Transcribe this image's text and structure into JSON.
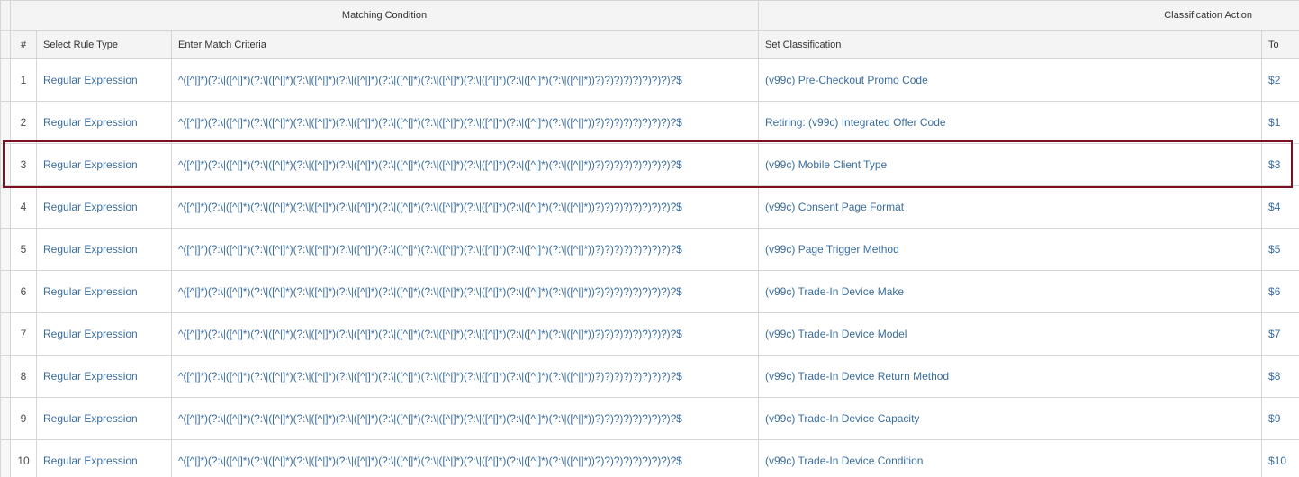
{
  "table": {
    "group_headers": {
      "matching_condition": "Matching Condition",
      "classification_action": "Classification Action"
    },
    "columns": {
      "num": "#",
      "rule_type": "Select Rule Type",
      "match_criteria": "Enter Match Criteria",
      "set_classification": "Set Classification",
      "to": "To"
    },
    "rows": [
      {
        "num": "1",
        "rule_type": "Regular Expression",
        "criteria": "^([^|]*)(?:\\|([^|]*)(?:\\|([^|]*)(?:\\|([^|]*)(?:\\|([^|]*)(?:\\|([^|]*)(?:\\|([^|]*)(?:\\|([^|]*)(?:\\|([^|]*)(?:\\|([^|]*))?)?)?)?)?)?)?)?)?$",
        "classification": "(v99c) Pre-Checkout Promo Code",
        "to": "$2"
      },
      {
        "num": "2",
        "rule_type": "Regular Expression",
        "criteria": "^([^|]*)(?:\\|([^|]*)(?:\\|([^|]*)(?:\\|([^|]*)(?:\\|([^|]*)(?:\\|([^|]*)(?:\\|([^|]*)(?:\\|([^|]*)(?:\\|([^|]*)(?:\\|([^|]*))?)?)?)?)?)?)?)?)?$",
        "classification": "Retiring: (v99c) Integrated Offer Code",
        "to": "$1"
      },
      {
        "num": "3",
        "rule_type": "Regular Expression",
        "criteria": "^([^|]*)(?:\\|([^|]*)(?:\\|([^|]*)(?:\\|([^|]*)(?:\\|([^|]*)(?:\\|([^|]*)(?:\\|([^|]*)(?:\\|([^|]*)(?:\\|([^|]*)(?:\\|([^|]*))?)?)?)?)?)?)?)?)?$",
        "classification": "(v99c) Mobile Client Type",
        "to": "$3"
      },
      {
        "num": "4",
        "rule_type": "Regular Expression",
        "criteria": "^([^|]*)(?:\\|([^|]*)(?:\\|([^|]*)(?:\\|([^|]*)(?:\\|([^|]*)(?:\\|([^|]*)(?:\\|([^|]*)(?:\\|([^|]*)(?:\\|([^|]*)(?:\\|([^|]*))?)?)?)?)?)?)?)?)?$",
        "classification": "(v99c) Consent Page Format",
        "to": "$4"
      },
      {
        "num": "5",
        "rule_type": "Regular Expression",
        "criteria": "^([^|]*)(?:\\|([^|]*)(?:\\|([^|]*)(?:\\|([^|]*)(?:\\|([^|]*)(?:\\|([^|]*)(?:\\|([^|]*)(?:\\|([^|]*)(?:\\|([^|]*)(?:\\|([^|]*))?)?)?)?)?)?)?)?)?$",
        "classification": "(v99c) Page Trigger Method",
        "to": "$5"
      },
      {
        "num": "6",
        "rule_type": "Regular Expression",
        "criteria": "^([^|]*)(?:\\|([^|]*)(?:\\|([^|]*)(?:\\|([^|]*)(?:\\|([^|]*)(?:\\|([^|]*)(?:\\|([^|]*)(?:\\|([^|]*)(?:\\|([^|]*)(?:\\|([^|]*))?)?)?)?)?)?)?)?)?$",
        "classification": "(v99c) Trade-In Device Make",
        "to": "$6"
      },
      {
        "num": "7",
        "rule_type": "Regular Expression",
        "criteria": "^([^|]*)(?:\\|([^|]*)(?:\\|([^|]*)(?:\\|([^|]*)(?:\\|([^|]*)(?:\\|([^|]*)(?:\\|([^|]*)(?:\\|([^|]*)(?:\\|([^|]*)(?:\\|([^|]*))?)?)?)?)?)?)?)?)?$",
        "classification": "(v99c) Trade-In Device Model",
        "to": "$7"
      },
      {
        "num": "8",
        "rule_type": "Regular Expression",
        "criteria": "^([^|]*)(?:\\|([^|]*)(?:\\|([^|]*)(?:\\|([^|]*)(?:\\|([^|]*)(?:\\|([^|]*)(?:\\|([^|]*)(?:\\|([^|]*)(?:\\|([^|]*)(?:\\|([^|]*))?)?)?)?)?)?)?)?)?$",
        "classification": "(v99c) Trade-In Device Return Method",
        "to": "$8"
      },
      {
        "num": "9",
        "rule_type": "Regular Expression",
        "criteria": "^([^|]*)(?:\\|([^|]*)(?:\\|([^|]*)(?:\\|([^|]*)(?:\\|([^|]*)(?:\\|([^|]*)(?:\\|([^|]*)(?:\\|([^|]*)(?:\\|([^|]*)(?:\\|([^|]*))?)?)?)?)?)?)?)?)?$",
        "classification": "(v99c) Trade-In Device Capacity",
        "to": "$9"
      },
      {
        "num": "10",
        "rule_type": "Regular Expression",
        "criteria": "^([^|]*)(?:\\|([^|]*)(?:\\|([^|]*)(?:\\|([^|]*)(?:\\|([^|]*)(?:\\|([^|]*)(?:\\|([^|]*)(?:\\|([^|]*)(?:\\|([^|]*)(?:\\|([^|]*))?)?)?)?)?)?)?)?)?$",
        "classification": "(v99c) Trade-In Device Condition",
        "to": "$10"
      }
    ],
    "highlighted_row": 3
  },
  "colors": {
    "link_text": "#3a6d9f",
    "header_bg": "#f4f4f4",
    "border": "#d6d6d6",
    "highlight_border": "#7a1020"
  }
}
